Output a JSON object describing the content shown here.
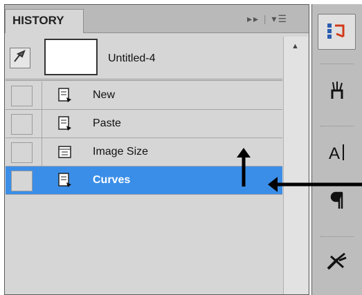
{
  "history_panel": {
    "tab_label": "HISTORY",
    "snapshot": {
      "label": "Untitled-4"
    },
    "steps": [
      {
        "label": "New",
        "icon": "new-document-icon",
        "selected": false
      },
      {
        "label": "Paste",
        "icon": "paste-document-icon",
        "selected": false
      },
      {
        "label": "Image Size",
        "icon": "image-size-icon",
        "selected": false
      },
      {
        "label": "Curves",
        "icon": "curves-document-icon",
        "selected": true
      }
    ]
  },
  "sidebar": {
    "buttons": [
      {
        "icon": "history-panel-icon",
        "active": true
      },
      {
        "icon": "brush-presets-icon",
        "active": false
      },
      {
        "icon": "character-icon",
        "active": false
      },
      {
        "icon": "paragraph-icon",
        "active": false
      },
      {
        "icon": "tool-presets-icon",
        "active": false
      }
    ]
  },
  "colors": {
    "selection": "#3b8ee8",
    "panel_bg": "#d6d6d6",
    "sidebar_bg": "#bdbdbd"
  }
}
